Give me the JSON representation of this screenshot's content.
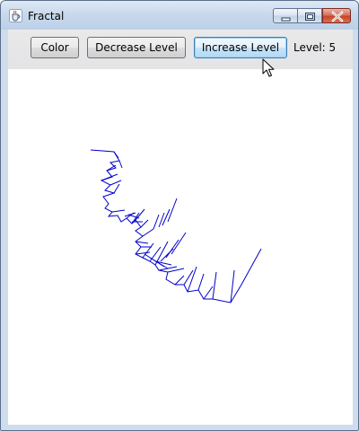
{
  "window": {
    "title": "Fractal",
    "app_icon": "java-cup-icon",
    "caption_buttons": [
      "minimize-icon",
      "maximize-icon",
      "close-icon"
    ]
  },
  "toolbar": {
    "color_label": "Color",
    "decrease_label": "Decrease Level",
    "increase_label": "Increase Level",
    "level_text": "Level: 5"
  },
  "canvas": {
    "line_color": "#0000cc",
    "background": "#ffffff"
  },
  "colors": {
    "accent": "#3c7fb1",
    "close": "#c7452b"
  },
  "cursor": "arrow-pointer-icon"
}
